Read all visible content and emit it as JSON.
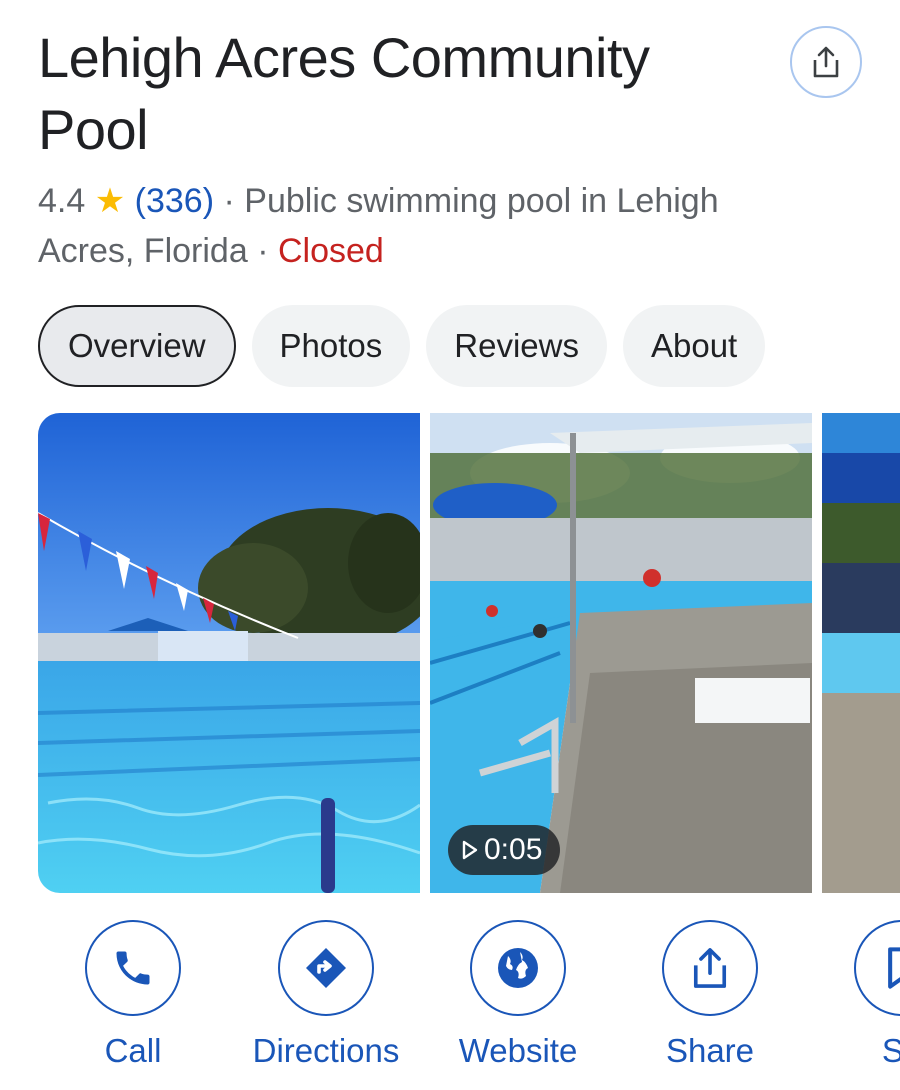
{
  "place": {
    "name": "Lehigh Acres Community Pool",
    "rating": "4.4",
    "review_count": "(336)",
    "separator": "·",
    "category_location": "Public swimming pool in Lehigh Acres, Florida",
    "status": "Closed"
  },
  "header": {
    "share_icon": "share-icon"
  },
  "tabs": [
    {
      "label": "Overview",
      "active": true
    },
    {
      "label": "Photos",
      "active": false
    },
    {
      "label": "Reviews",
      "active": false
    },
    {
      "label": "About",
      "active": false
    }
  ],
  "photos": {
    "video_duration": "0:05"
  },
  "actions": [
    {
      "label": "Call",
      "icon": "phone-icon"
    },
    {
      "label": "Directions",
      "icon": "directions-icon"
    },
    {
      "label": "Website",
      "icon": "globe-icon"
    },
    {
      "label": "Share",
      "icon": "share-icon"
    },
    {
      "label": "Sa",
      "icon": "bookmark-icon"
    }
  ],
  "colors": {
    "accent": "#1a56b8",
    "closed": "#c5221f",
    "star": "#fbbc04",
    "muted": "#5f6368"
  }
}
